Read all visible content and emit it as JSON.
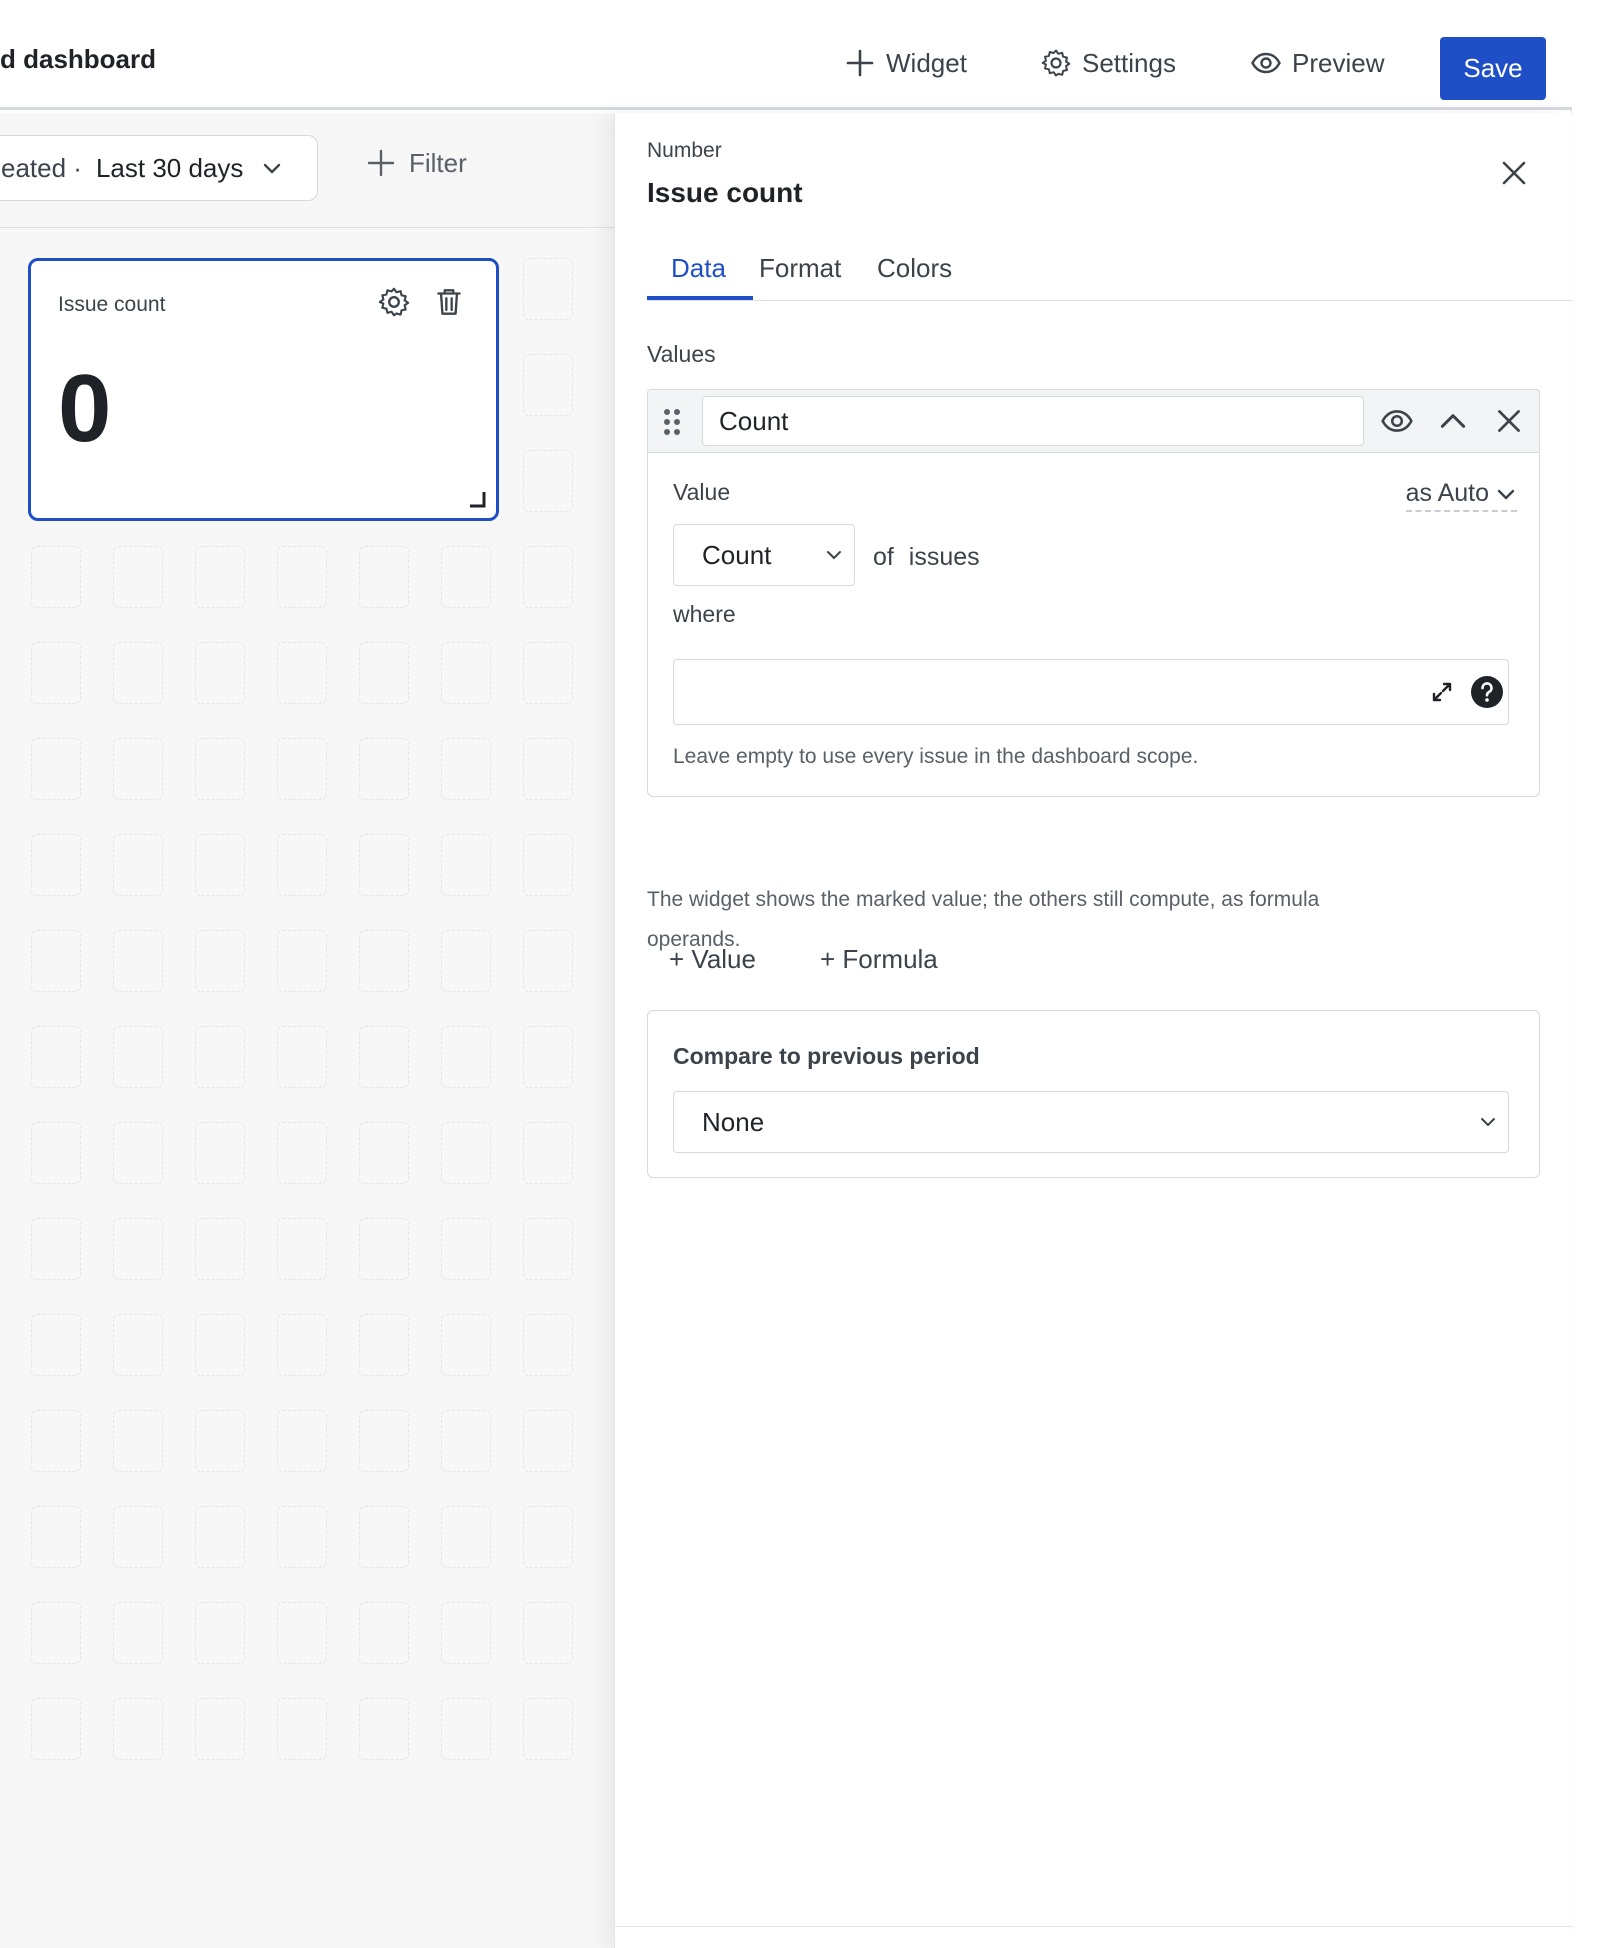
{
  "header": {
    "title": "d dashboard",
    "widget_label": "Widget",
    "settings_label": "Settings",
    "preview_label": "Preview",
    "save_label": "Save"
  },
  "filterbar": {
    "date_field": "eated ·",
    "date_value": "Last 30 days",
    "filter_label": "Filter"
  },
  "widget": {
    "title": "Issue count",
    "value": "0"
  },
  "panel": {
    "subtitle": "Number",
    "title": "Issue count",
    "tabs": [
      {
        "label": "Data",
        "active": true
      },
      {
        "label": "Format",
        "active": false
      },
      {
        "label": "Colors",
        "active": false
      }
    ],
    "values_label": "Values",
    "value_item": {
      "name": "Count",
      "value_label": "Value",
      "as_label": "as Auto",
      "aggregation": "Count",
      "of_label": "of issues",
      "where_label": "where",
      "where_value": "",
      "help_text": "Leave empty to use every issue in the dashboard scope."
    },
    "add_value_label": "+ Value",
    "add_formula_label": "+ Formula",
    "note": "The widget shows the marked value; the others still compute, as formula operands.",
    "compare": {
      "title": "Compare to previous period",
      "selected": "None"
    }
  },
  "colors": {
    "accent": "#1f4fc7"
  }
}
